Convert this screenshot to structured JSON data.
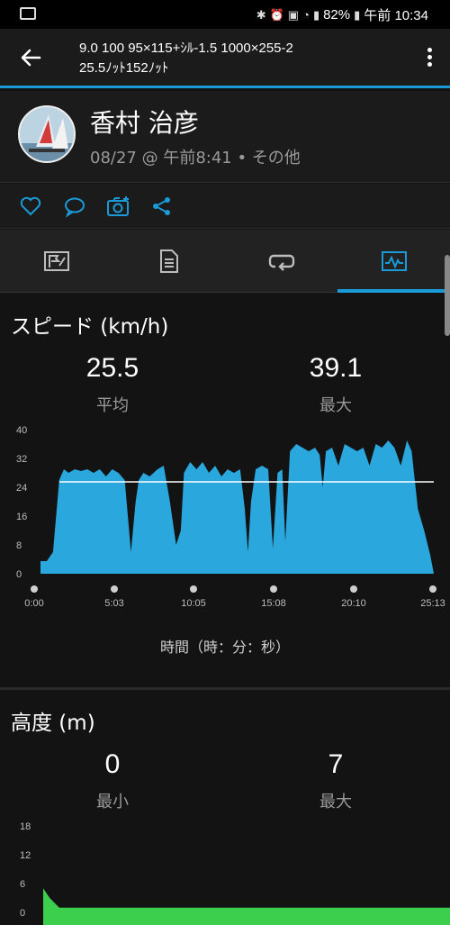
{
  "status_bar": {
    "battery": "82%",
    "time": "午前 10:34"
  },
  "app_bar": {
    "title_line1": "9.0 100 95×115+ｼﾙ-1.5 1000×255-2",
    "title_line2": "25.5ﾉｯﾄ152ﾉｯﾄ"
  },
  "profile": {
    "name": "香村 治彦",
    "meta": "08/27 @ 午前8:41 • その他"
  },
  "actions": [
    "heart-icon",
    "comment-icon",
    "camera-add-icon",
    "share-icon"
  ],
  "tabs": [
    "summary-tab",
    "details-tab",
    "laps-tab",
    "charts-tab"
  ],
  "speed": {
    "title": "スピード (km/h)",
    "avg_value": "25.5",
    "avg_label": "平均",
    "max_value": "39.1",
    "max_label": "最大",
    "x_axis_label": "時間（時：分：秒）"
  },
  "elevation": {
    "title": "高度 (m)",
    "min_value": "0",
    "min_label": "最小",
    "max_value": "7",
    "max_label": "最大"
  },
  "colors": {
    "accent": "#1a9bd7",
    "speed_fill": "#2aa7dd",
    "elev_fill": "#3ccf4e"
  },
  "chart_data": [
    {
      "type": "area",
      "name": "speed",
      "x_unit": "minutes",
      "x_ticks": [
        "0:00",
        "5:03",
        "10:05",
        "15:08",
        "20:10",
        "25:13"
      ],
      "y_ticks": [
        "0",
        "8",
        "16",
        "24",
        "32",
        "40"
      ],
      "ylim": [
        0,
        40
      ],
      "xlim": [
        0,
        25.22
      ],
      "average_line": 25.5,
      "x": [
        0,
        0.4,
        0.8,
        1.2,
        1.5,
        1.8,
        2.2,
        2.6,
        3.0,
        3.4,
        3.8,
        4.2,
        4.6,
        5.0,
        5.4,
        5.8,
        6.1,
        6.3,
        6.6,
        7.0,
        7.5,
        7.9,
        8.3,
        8.7,
        9.0,
        9.2,
        9.6,
        10.0,
        10.4,
        10.8,
        11.2,
        11.6,
        12.0,
        12.4,
        12.8,
        13.1,
        13.3,
        13.5,
        13.8,
        14.2,
        14.6,
        14.9,
        15.2,
        15.5,
        15.7,
        16.0,
        16.4,
        16.8,
        17.2,
        17.6,
        17.9,
        18.1,
        18.3,
        18.7,
        19.1,
        19.5,
        19.9,
        20.3,
        20.7,
        21.1,
        21.5,
        21.9,
        22.3,
        22.7,
        23.1,
        23.5,
        23.8,
        24.2,
        24.6,
        25.0,
        25.22
      ],
      "y": [
        3.5,
        3.5,
        6,
        26,
        29,
        28,
        29,
        28.5,
        29,
        28,
        29,
        27,
        29,
        28,
        26,
        6,
        20,
        26,
        28,
        27,
        29,
        30,
        20,
        8,
        12,
        28,
        31,
        29,
        31,
        28,
        30,
        27,
        29,
        28,
        29,
        18,
        6,
        20,
        29,
        30,
        29,
        7,
        28,
        29,
        9,
        34,
        36,
        35,
        34,
        35,
        33,
        24,
        34,
        35,
        30,
        36,
        35,
        34,
        35,
        30,
        36,
        35,
        37,
        35,
        30,
        37,
        34,
        18,
        12,
        5,
        0
      ]
    },
    {
      "type": "area",
      "name": "elevation",
      "y_ticks": [
        "0",
        "6",
        "12",
        "18"
      ],
      "ylim": [
        0,
        18
      ],
      "x": [
        0,
        0.4,
        1.0,
        2.0,
        25.22
      ],
      "y": [
        5,
        3,
        1,
        1,
        1
      ]
    }
  ]
}
